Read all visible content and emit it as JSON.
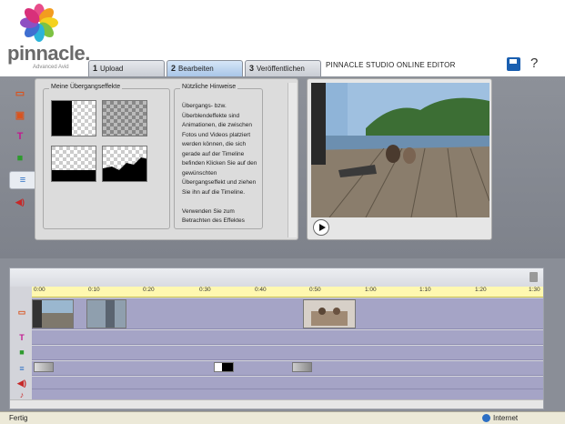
{
  "brand": {
    "name": "pinnacle.",
    "sub": "Advanced Avid"
  },
  "tabs": [
    {
      "num": "1",
      "label": "Upload"
    },
    {
      "num": "2",
      "label": "Bearbeiten"
    },
    {
      "num": "3",
      "label": "Veröffentlichen"
    }
  ],
  "editor_title": "PINNACLE STUDIO ONLINE EDITOR",
  "window": {
    "minimize": "_",
    "restore": "▫",
    "close": "x"
  },
  "side_tools": [
    {
      "glyph": "▭",
      "color": "#d9531e"
    },
    {
      "glyph": "▣",
      "color": "#d9531e"
    },
    {
      "glyph": "T",
      "color": "#c2188f"
    },
    {
      "glyph": "■",
      "color": "#2e9a2e"
    },
    {
      "glyph": "≡",
      "color": "#2c6fc4"
    },
    {
      "glyph": "◀)",
      "color": "#c62828"
    }
  ],
  "effects_panel": {
    "title": "Meine Übergangseffekte"
  },
  "hints": {
    "title": "Nützliche Hinweise",
    "body": "Übergangs- bzw. Überblendeffekte sind Animationen, die zwischen Fotos und Videos platziert werden können, die sich gerade auf der Timeline befinden Klicken Sie auf den gewünschten Übergangseffekt und ziehen Sie ihn auf die Timeline.",
    "body2": "Verwenden Sie zum Betrachten des Effektes"
  },
  "timeline": {
    "ticks": [
      "0:00",
      "0:10",
      "0:20",
      "0:30",
      "0:40",
      "0:50",
      "1:00",
      "1:10",
      "1:20",
      "1:30"
    ]
  },
  "status": {
    "left": "Fertig",
    "right": "Internet"
  }
}
